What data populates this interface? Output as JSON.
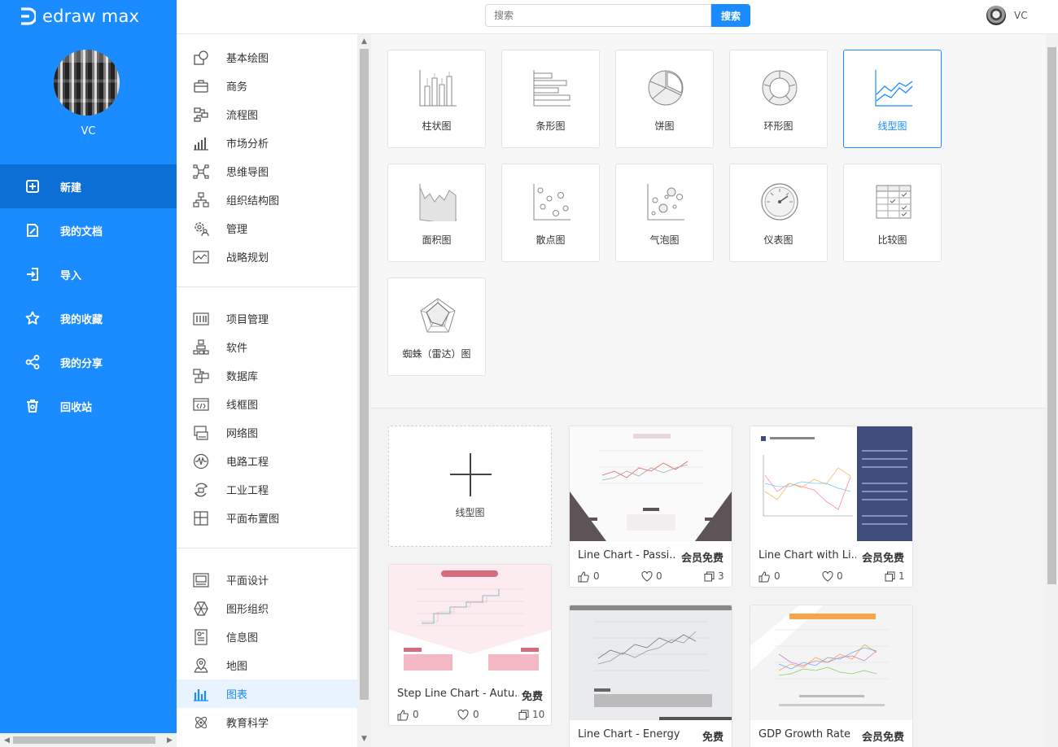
{
  "app": {
    "brand": "edraw max"
  },
  "user": {
    "name": "VC"
  },
  "search": {
    "placeholder": "搜索",
    "button": "搜索"
  },
  "nav": [
    {
      "label": "新建",
      "icon": "new-file-icon",
      "active": true
    },
    {
      "label": "我的文档",
      "icon": "documents-icon"
    },
    {
      "label": "导入",
      "icon": "import-icon"
    },
    {
      "label": "我的收藏",
      "icon": "star-icon"
    },
    {
      "label": "我的分享",
      "icon": "share-icon"
    },
    {
      "label": "回收站",
      "icon": "trash-icon"
    }
  ],
  "categories": {
    "group1": [
      {
        "label": "基本绘图",
        "icon": "shapes-icon"
      },
      {
        "label": "商务",
        "icon": "briefcase-icon"
      },
      {
        "label": "流程图",
        "icon": "flowchart-icon"
      },
      {
        "label": "市场分析",
        "icon": "bar-chart-icon"
      },
      {
        "label": "思维导图",
        "icon": "mindmap-icon"
      },
      {
        "label": "组织结构图",
        "icon": "org-chart-icon"
      },
      {
        "label": "管理",
        "icon": "gear-user-icon"
      },
      {
        "label": "战略规划",
        "icon": "strategy-icon"
      }
    ],
    "group2": [
      {
        "label": "项目管理",
        "icon": "project-icon"
      },
      {
        "label": "软件",
        "icon": "software-icon"
      },
      {
        "label": "数据库",
        "icon": "database-icon"
      },
      {
        "label": "线框图",
        "icon": "wireframe-icon"
      },
      {
        "label": "网络图",
        "icon": "network-icon"
      },
      {
        "label": "电路工程",
        "icon": "circuit-icon"
      },
      {
        "label": "工业工程",
        "icon": "industrial-icon"
      },
      {
        "label": "平面布置图",
        "icon": "floorplan-icon"
      }
    ],
    "group3": [
      {
        "label": "平面设计",
        "icon": "graphic-design-icon"
      },
      {
        "label": "图形组织",
        "icon": "graphic-organizer-icon"
      },
      {
        "label": "信息图",
        "icon": "infographic-icon"
      },
      {
        "label": "地图",
        "icon": "map-pin-icon"
      },
      {
        "label": "图表",
        "icon": "chart-icon",
        "active": true
      },
      {
        "label": "教育科学",
        "icon": "atom-icon"
      }
    ]
  },
  "chart_types": [
    {
      "label": "柱状图",
      "icon": "column-chart-icon"
    },
    {
      "label": "条形图",
      "icon": "bar-chart-icon"
    },
    {
      "label": "饼图",
      "icon": "pie-chart-icon"
    },
    {
      "label": "环形图",
      "icon": "donut-chart-icon"
    },
    {
      "label": "线型图",
      "icon": "line-chart-icon",
      "selected": true
    },
    {
      "label": "面积图",
      "icon": "area-chart-icon"
    },
    {
      "label": "散点图",
      "icon": "scatter-chart-icon"
    },
    {
      "label": "气泡图",
      "icon": "bubble-chart-icon"
    },
    {
      "label": "仪表图",
      "icon": "gauge-chart-icon"
    },
    {
      "label": "比较图",
      "icon": "comparison-chart-icon"
    },
    {
      "label": "蜘蛛（雷达）图",
      "icon": "radar-chart-icon"
    }
  ],
  "new_blank": {
    "label": "线型图"
  },
  "templates": [
    {
      "title": "Line Chart - Passi...",
      "price": "会员免费",
      "likes": "0",
      "favorites": "0",
      "copies": "3"
    },
    {
      "title": "Line Chart with Li...",
      "price": "会员免费",
      "likes": "0",
      "favorites": "0",
      "copies": "1"
    },
    {
      "title": "Step Line Chart - Autu...",
      "price": "免费",
      "likes": "0",
      "favorites": "0",
      "copies": "10"
    },
    {
      "title": "Line Chart - Energy",
      "price": "免费"
    },
    {
      "title": "GDP Growth Rate",
      "price": "会员免费"
    }
  ],
  "colors": {
    "accent": "#1a8cff",
    "sidebar": "#1a8cff",
    "sidebar_active": "#0b6fd6"
  }
}
